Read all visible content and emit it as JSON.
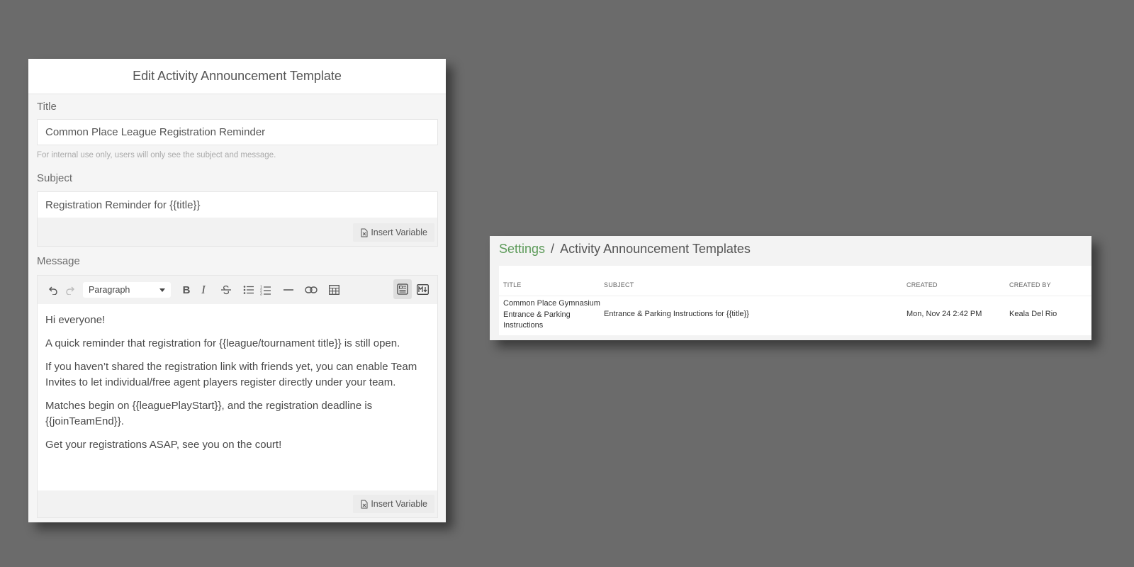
{
  "editor": {
    "heading": "Edit Activity Announcement Template",
    "title_label": "Title",
    "title_value": "Common Place League Registration Reminder",
    "title_help": "For internal use only, users will only see the subject and message.",
    "subject_label": "Subject",
    "subject_value": "Registration Reminder for  {{title}}",
    "insert_variable_label": "Insert Variable",
    "message_label": "Message",
    "toolbar": {
      "block_format": "Paragraph",
      "icons": [
        "undo-icon",
        "redo-icon",
        "bold-icon",
        "italic-icon",
        "strikethrough-icon",
        "bullet-list-icon",
        "numbered-list-icon",
        "horizontal-rule-icon",
        "link-icon",
        "table-icon",
        "wysiwyg-mode-icon",
        "markdown-mode-icon"
      ]
    },
    "message_paragraphs": [
      "Hi everyone!",
      "A quick reminder that registration for {{league/tournament title}} is still open.",
      "If you haven’t shared the registration link with friends yet, you can enable Team Invites to let individual/free agent players register directly under your team.",
      "Matches begin on {{leaguePlayStart}}, and the registration deadline is {{joinTeamEnd}}.",
      "Get your registrations ASAP, see you on the court!"
    ]
  },
  "templates": {
    "breadcrumb": {
      "parent": "Settings",
      "separator": "/",
      "current": "Activity Announcement Templates"
    },
    "columns": [
      "TITLE",
      "SUBJECT",
      "CREATED",
      "CREATED BY"
    ],
    "rows": [
      {
        "title": "Common Place Gymnasium Entrance & Parking Instructions",
        "subject": "Entrance & Parking Instructions for {{title}}",
        "created": "Mon, Nov 24 2:42 PM",
        "created_by": "Keala Del Rio"
      }
    ]
  },
  "colors": {
    "background": "#6b6b6b",
    "link_green": "#5d9b5a"
  }
}
